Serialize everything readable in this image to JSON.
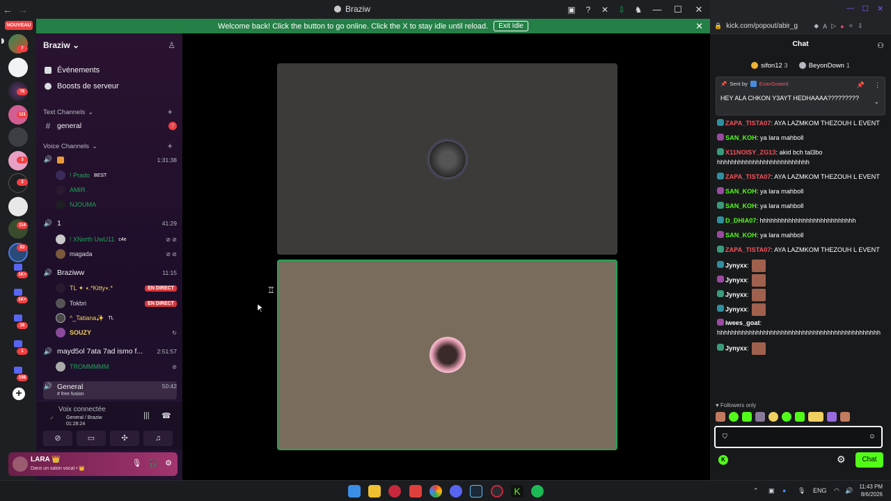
{
  "discord": {
    "window_title": "Braziw",
    "banner": {
      "text": "Welcome back! Click the button to go online. Click the X to stay idle until reload.",
      "button": "Exit Idle"
    },
    "rail": {
      "nouveau_label": "NOUVEAU",
      "badges": [
        "7",
        "76",
        "121",
        "3",
        "2",
        "114",
        "83",
        "1K+",
        "1K+",
        "26",
        "1",
        "108"
      ]
    },
    "server_name": "Braziw",
    "menu": [
      "Événements",
      "Boosts de serveur"
    ],
    "text_category": "Text Channels",
    "text_channels": [
      {
        "name": "general",
        "badge": "7"
      }
    ],
    "voice_category": "Voice Channels",
    "voice_channels": [
      {
        "name": "",
        "time": "1:31:38",
        "users": [
          {
            "name": "! Prado",
            "tag": "BEST"
          },
          {
            "name": "AMIR .",
            "tag": ""
          },
          {
            "name": "NJOUMA",
            "tag": ""
          }
        ]
      },
      {
        "name": "1",
        "time": "41:29",
        "users": [
          {
            "name": "! XNorth UwU11",
            "tag": "c4e"
          },
          {
            "name": "magada",
            "tag": ""
          }
        ]
      },
      {
        "name": "Braziww",
        "time": "11:15",
        "users": [
          {
            "name": "TL ✦ ⭑.*Kitty⭑.*",
            "tag": "EN DIRECT"
          },
          {
            "name": "Tokbri",
            "tag": "EN DIRECT"
          },
          {
            "name": "^_Tatiana✨",
            "tag": "TL"
          },
          {
            "name": "SOUZY",
            "tag": ""
          }
        ]
      },
      {
        "name": "mayd5ol 7ata 7ad ismo f...",
        "time": "2:51:57",
        "users": [
          {
            "name": "TROMMMMM",
            "tag": ""
          }
        ]
      },
      {
        "name": "General",
        "time": "50:42",
        "subtitle": "# free fusion",
        "users": []
      }
    ],
    "voice_panel": {
      "title": "Voix connectée",
      "location": "General / Braziw",
      "elapsed": "01:28:24"
    },
    "user_panel": {
      "name": "LARA 👑",
      "status": "Dans un salon vocal • 👑"
    }
  },
  "kick": {
    "url": "kick.com/popout/abir_g",
    "header": "Chat",
    "gifters": [
      {
        "name": "sifon12",
        "count": "3"
      },
      {
        "name": "BeyonDown",
        "count": "1"
      }
    ],
    "pinned": {
      "sent_by": "Sent by",
      "author": "EvanGoated",
      "text": "HEY ALA CHKON Y3AYT HEDHAAAA?????????"
    },
    "messages": [
      {
        "badge": "31",
        "name": "ZAPA_TISTA07",
        "color": "#f2545b",
        "text": ": AYA LAZMKOM THEZOUH L EVENT"
      },
      {
        "badge": "25",
        "name": "SAN_KOH",
        "color": "#53fc18",
        "text": ": ya lara mahboll"
      },
      {
        "badge": "25",
        "name": "X11NOISY_ZG13",
        "color": "#f2545b",
        "text": ": akid bch tal3bo hhhhhhhhhhhhhhhhhhhhhhhhhh"
      },
      {
        "badge": "31",
        "name": "ZAPA_TISTA07",
        "color": "#f2545b",
        "text": ": AYA LAZMKOM THEZOUH L EVENT"
      },
      {
        "badge": "25",
        "name": "SAN_KOH",
        "color": "#53fc18",
        "text": ": ya lara mahboll"
      },
      {
        "badge": "25",
        "name": "SAN_KOH",
        "color": "#53fc18",
        "text": ": ya lara mahboll"
      },
      {
        "badge": "30",
        "name": "D_DHIA07",
        "color": "#53fc18",
        "text": ": hhhhhhhhhhhhhhhhhhhhhhhhhhh"
      },
      {
        "badge": "25",
        "name": "SAN_KOH",
        "color": "#53fc18",
        "text": ": ya lara mahboll"
      },
      {
        "badge": "31",
        "name": "ZAPA_TISTA07",
        "color": "#f2545b",
        "text": ": AYA LAZMKOM THEZOUH L EVENT"
      },
      {
        "badge": "34",
        "name": "Jynyxx",
        "color": "#ffffff",
        "text": ":",
        "emote": true
      },
      {
        "badge": "34",
        "name": "Jynyxx",
        "color": "#ffffff",
        "text": ":",
        "emote": true
      },
      {
        "badge": "34",
        "name": "Jynyxx",
        "color": "#ffffff",
        "text": ":",
        "emote": true
      },
      {
        "badge": "34",
        "name": "Jynyxx",
        "color": "#ffffff",
        "text": ":",
        "emote": true
      },
      {
        "badge": "25",
        "name": "iwees_goat",
        "color": "#ffffff",
        "text": ": hhhhhhhhhhhhhhhhhhhhhhhhhhhhhhhhhhhhhhhhhhhhhh"
      },
      {
        "badge": "34",
        "name": "Jynyxx",
        "color": "#ffffff",
        "text": ":",
        "emote": true
      }
    ],
    "followers_only": "Followers only",
    "chat_button": "Chat"
  },
  "taskbar": {
    "lang": "ENG",
    "time": "11:43 PM",
    "date": "8/6/2026"
  }
}
